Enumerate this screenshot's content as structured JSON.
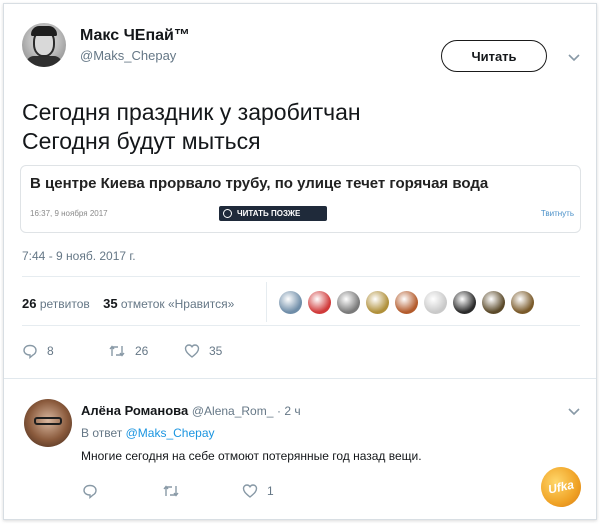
{
  "tweet": {
    "author_name": "Макс ЧЕпай™",
    "author_handle": "@Maks_Chepay",
    "follow_label": "Читать",
    "text_line1": "Сегодня праздник у заробитчан",
    "text_line2": "Сегодня будут мыться",
    "timestamp": "7:44 - 9 нояб. 2017 г."
  },
  "card": {
    "headline": "В центре Киева прорвало трубу, по улице течет горячая вода",
    "date": "16:37, 9 ноября 2017",
    "read_later": "ЧИТАТЬ ПОЗЖЕ",
    "tweet_link": "Твитнуть"
  },
  "stats": {
    "retweets_count": "26",
    "retweets_label": "ретвитов",
    "likes_count": "35",
    "likes_label": "отметок «Нравится»"
  },
  "likers": [
    {
      "name": "liker-1",
      "color": "#6f8da8"
    },
    {
      "name": "liker-2",
      "color": "#d03a3a"
    },
    {
      "name": "liker-3",
      "color": "#7a7a7a"
    },
    {
      "name": "liker-4",
      "color": "#b0903a"
    },
    {
      "name": "liker-5",
      "color": "#b35b2c"
    },
    {
      "name": "liker-6",
      "color": "#c9c9c9"
    },
    {
      "name": "liker-7",
      "color": "#2b2b2b"
    },
    {
      "name": "liker-8",
      "color": "#5b4a2a"
    },
    {
      "name": "liker-9",
      "color": "#7a5a2a"
    }
  ],
  "actions": {
    "reply_count": "8",
    "retweet_count": "26",
    "like_count": "35"
  },
  "reply": {
    "author_name": "Алёна Романова",
    "author_handle": "@Alena_Rom_",
    "time": "· 2 ч",
    "in_reply_prefix": "В ответ",
    "in_reply_handle": "@Maks_Chepay",
    "text": "Многие сегодня на себе отмоют потерянные год назад вещи.",
    "reply_count": "",
    "retweet_count": "",
    "like_count": "1"
  },
  "watermark": "Ufka",
  "colors": {
    "accent": "#1b95e0",
    "muted": "#657786",
    "text": "#14171a"
  }
}
